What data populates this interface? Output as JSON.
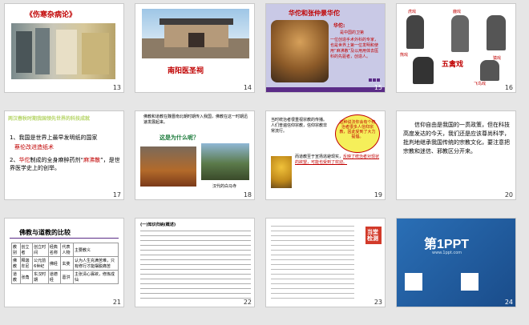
{
  "slides": [
    {
      "num": "13",
      "title": "《伤寒杂病论》"
    },
    {
      "num": "14",
      "caption": "南阳医圣祠"
    },
    {
      "num": "15",
      "title": "华佗和张仲景华佗",
      "name": "华佗:",
      "l1": "是中国的卫第",
      "l2": "一位创造手术外科的专家，也是世界上第一位发明和使用“麻沸散”及以用用体去医科的先驱者，创造人。"
    },
    {
      "num": "16",
      "l1": "虎戏",
      "l2": "鹿戏",
      "l3": "五禽戏",
      "l4": "熊戏",
      "l5": "猿戏",
      "l6": "飞鸟戏"
    },
    {
      "num": "17",
      "header": "两汉春秋时期我国领先世界的科技成就",
      "p1": "1、我国是世界上最早发明纸的国家",
      "p1b": "蔡伦改进造纸术",
      "p2a": "2、",
      "p2name": "华佗",
      "p2b": "制成的全身麻醉药剂“",
      "p2drug": "麻沸散",
      "p2c": "”，是世界医学史上的创举。"
    },
    {
      "num": "18",
      "top": "佛教和道教在魏晋南北朝时期传入我国，佛教在这一时期迅速发展起来。",
      "q": "这是为什么呢？",
      "cap": "汉代的白马寺"
    },
    {
      "num": "19",
      "p1": "当时统治者很重视宗教的传播。人们普遍信仰宗教，信仰宗教非常流行。",
      "bubble": "这种说法你会有个统治者很多人信仰宗教，因此受到了大力提倡。",
      "p2a": "而道教至于宣扬",
      "p2b": "逃避现实，",
      "p2c": "反映了统治者对现状的欲望，可能也受到了欢迎。"
    },
    {
      "num": "20",
      "text": "信仰自由是我国的一贯政策，但在科技高度发达的今天，我们还是应该尊尚科学，批判地继承我国传统的宗教文化，要注意把宗教和迷信、邪教区分开来。"
    },
    {
      "num": "21",
      "title": "佛教与道教的比较",
      "h": [
        "教别",
        "创立者",
        "创立时间",
        "经典名称",
        "代表人物",
        "主要教义"
      ],
      "r1": [
        "佛教",
        "释迦牟尼",
        "公元前6世纪",
        "佛经",
        "玄奘",
        "认为人生充满苦难，只有修行才能摆脱痛苦"
      ],
      "r2": [
        "道教",
        "张角",
        "东汉时期",
        "道德经",
        "葛洪",
        "主张清心寡欲，修炼成仙"
      ]
    },
    {
      "num": "22",
      "title": "(一)知识归纳(概述)"
    },
    {
      "num": "23",
      "tag": "当堂检测"
    },
    {
      "num": "24",
      "brand": "第1PPT",
      "sub": "www.1ppt.com"
    }
  ]
}
